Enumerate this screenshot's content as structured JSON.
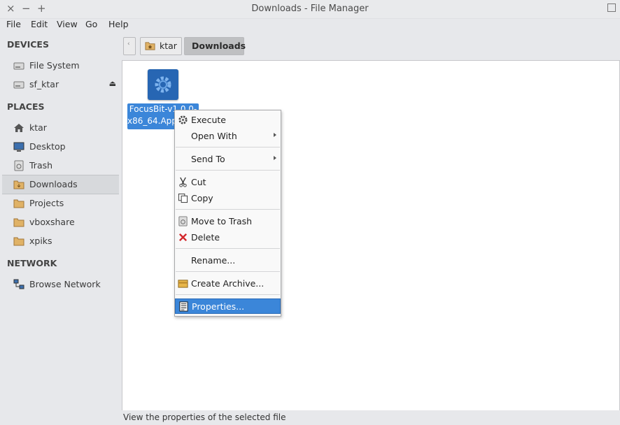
{
  "window": {
    "title": "Downloads - File Manager",
    "controls": {
      "close": "×",
      "minimize": "−",
      "maximize_extra": "+"
    }
  },
  "menubar": {
    "items": [
      "File",
      "Edit",
      "View",
      "Go",
      "Help"
    ]
  },
  "sidebar": {
    "devices_header": "DEVICES",
    "devices": [
      {
        "label": "File System",
        "icon": "drive-icon"
      },
      {
        "label": "sf_ktar",
        "icon": "drive-icon"
      }
    ],
    "places_header": "PLACES",
    "places": [
      {
        "label": "ktar",
        "icon": "home-icon"
      },
      {
        "label": "Desktop",
        "icon": "desktop-icon"
      },
      {
        "label": "Trash",
        "icon": "trash-icon"
      },
      {
        "label": "Downloads",
        "icon": "folder-download-icon",
        "selected": true
      },
      {
        "label": "Projects",
        "icon": "folder-icon"
      },
      {
        "label": "vboxshare",
        "icon": "folder-icon"
      },
      {
        "label": "xpiks",
        "icon": "folder-icon"
      }
    ],
    "network_header": "NETWORK",
    "network": [
      {
        "label": "Browse Network",
        "icon": "network-icon"
      }
    ]
  },
  "pathbar": {
    "crumbs": [
      "ktar",
      "Downloads"
    ]
  },
  "file": {
    "label_line1": "FocusBit-v1.0.0-",
    "label_line2": "x86_64.AppImage"
  },
  "context_menu": {
    "items": {
      "execute": "Execute",
      "open_with": "Open With",
      "send_to": "Send To",
      "cut": "Cut",
      "copy": "Copy",
      "move_to_trash": "Move to Trash",
      "delete": "Delete",
      "rename": "Rename...",
      "create_archive": "Create Archive...",
      "properties": "Properties..."
    }
  },
  "status": {
    "text": "View the properties of the selected file"
  },
  "colors": {
    "accent": "#3b86d9",
    "sidebar_bg": "#e7e8eb"
  }
}
